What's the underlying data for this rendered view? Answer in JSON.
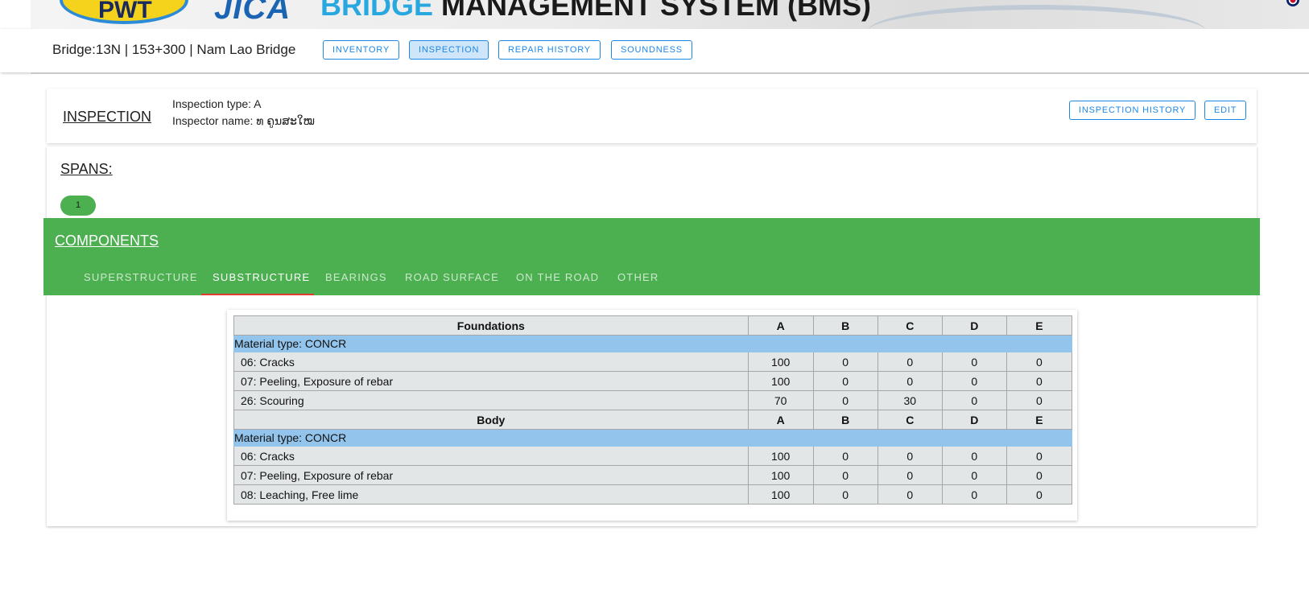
{
  "banner": {
    "logo_left": "PWT",
    "logo_right": "JICA",
    "title_accent": "BRIDGE",
    "title_rest": " MANAGEMENT SYSTEM (BMS)"
  },
  "header": {
    "bridge_title": "Bridge:13N | 153+300 | Nam Lao Bridge",
    "nav": [
      {
        "label": "INVENTORY",
        "active": false
      },
      {
        "label": "INSPECTION",
        "active": true
      },
      {
        "label": "REPAIR HISTORY",
        "active": false
      },
      {
        "label": "SOUNDNESS",
        "active": false
      }
    ]
  },
  "inspection": {
    "heading": "INSPECTION",
    "type_line": "Inspection type: A",
    "inspector_line": "Inspector name: ທ ຄູນສະໃໝ",
    "history_button": "INSPECTION HISTORY",
    "edit_button": "EDIT"
  },
  "spans": {
    "heading": "SPANS:",
    "items": [
      "1"
    ]
  },
  "components": {
    "heading": "COMPONENTS",
    "tabs": [
      {
        "label": "SUPERSTRUCTURE",
        "active": false
      },
      {
        "label": "SUBSTRUCTURE",
        "active": true
      },
      {
        "label": "BEARINGS",
        "active": false
      },
      {
        "label": "ROAD SURFACE",
        "active": false
      },
      {
        "label": "ON THE ROAD",
        "active": false
      },
      {
        "label": "OTHER",
        "active": false
      }
    ]
  },
  "table": {
    "grade_headers": [
      "A",
      "B",
      "C",
      "D",
      "E"
    ],
    "sections": [
      {
        "name": "Foundations",
        "material": "Material type: CONCR",
        "rows": [
          {
            "label": "06: Cracks",
            "values": [
              "100",
              "0",
              "0",
              "0",
              "0"
            ]
          },
          {
            "label": "07: Peeling, Exposure of rebar",
            "values": [
              "100",
              "0",
              "0",
              "0",
              "0"
            ]
          },
          {
            "label": "26: Scouring",
            "values": [
              "70",
              "0",
              "30",
              "0",
              "0"
            ]
          }
        ]
      },
      {
        "name": "Body",
        "material": "Material type: CONCR",
        "rows": [
          {
            "label": "06: Cracks",
            "values": [
              "100",
              "0",
              "0",
              "0",
              "0"
            ]
          },
          {
            "label": "07: Peeling, Exposure of rebar",
            "values": [
              "100",
              "0",
              "0",
              "0",
              "0"
            ]
          },
          {
            "label": "08: Leaching, Free lime",
            "values": [
              "100",
              "0",
              "0",
              "0",
              "0"
            ]
          }
        ]
      }
    ]
  },
  "colors": {
    "accent_blue": "#1e88e5",
    "component_green": "#4caf50",
    "tab_indicator": "#e53935",
    "material_row": "#93c4ec"
  }
}
